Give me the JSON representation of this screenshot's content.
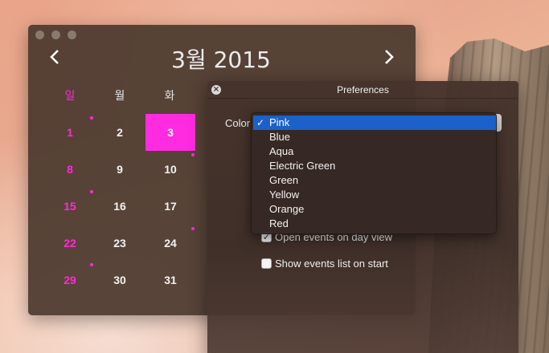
{
  "calendar": {
    "month_title": "3월 2015",
    "prev_glyph": "‹",
    "next_glyph": "›",
    "weekdays": [
      "일",
      "월",
      "화"
    ],
    "weeks": [
      [
        "1",
        "2",
        "3"
      ],
      [
        "8",
        "9",
        "10"
      ],
      [
        "15",
        "16",
        "17"
      ],
      [
        "22",
        "23",
        "24"
      ],
      [
        "29",
        "30",
        "31"
      ]
    ],
    "today": "3",
    "colors": {
      "accent": "#ff2be0",
      "window_bg": "#4e3a30"
    }
  },
  "preferences": {
    "title": "Preferences",
    "close_glyph": "×",
    "color_label": "Color",
    "color_options": [
      "Pink",
      "Blue",
      "Aqua",
      "Electric Green",
      "Green",
      "Yellow",
      "Orange",
      "Red"
    ],
    "selected_color": "Pink",
    "check_glyph": "✓",
    "checkboxes": [
      {
        "label": "Open events on day view",
        "checked": true
      },
      {
        "label": "Show events list on start",
        "checked": false
      }
    ],
    "colors": {
      "highlight": "#1b61c9"
    }
  }
}
